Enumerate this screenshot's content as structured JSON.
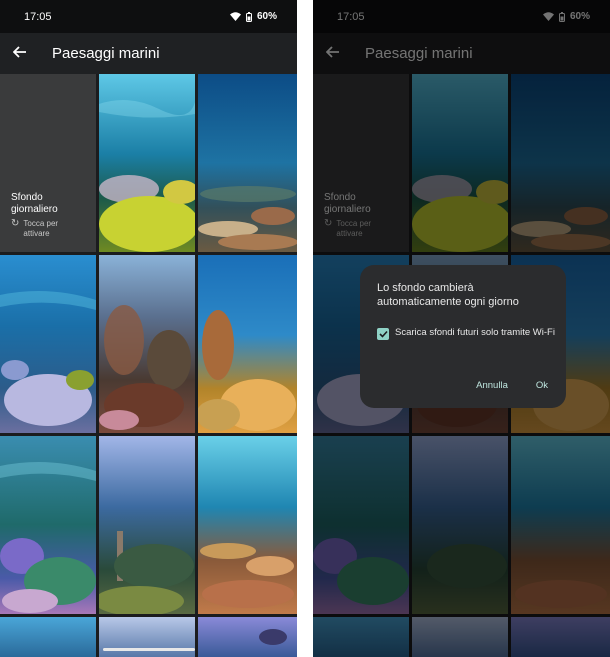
{
  "status": {
    "time": "17:05",
    "battery": "60%"
  },
  "app_bar": {
    "title": "Paesaggi marini"
  },
  "daily": {
    "title": "Sfondo giornaliero",
    "subtitle": "Tocca per attivare"
  },
  "dialog": {
    "title": "Lo sfondo cambierà automaticamente ogni giorno",
    "checkbox_label": "Scarica sfondi futuri solo tramite Wi-Fi",
    "checkbox_checked": true,
    "cancel_label": "Annulla",
    "ok_label": "Ok"
  },
  "colors": {
    "accent": "#8fd2c6",
    "background": "#1b1c1e",
    "dialog": "#2b2c2e"
  },
  "icons": {
    "back": "arrow-left-icon",
    "refresh": "refresh-icon",
    "wifi": "wifi-icon",
    "battery": "battery-icon"
  }
}
